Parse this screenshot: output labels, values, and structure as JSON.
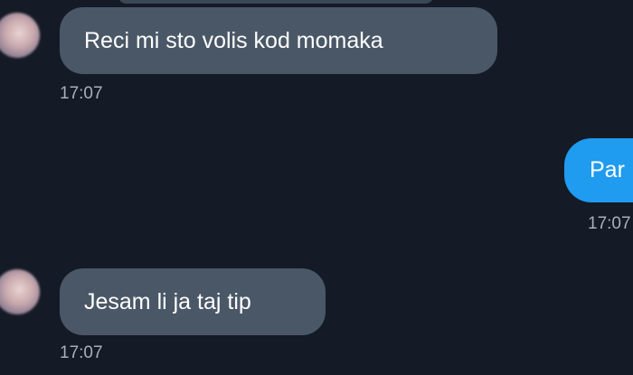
{
  "messages": [
    {
      "direction": "incoming",
      "text": "Reci mi sto volis kod momaka",
      "time": "17:07"
    },
    {
      "direction": "outgoing",
      "text": "Par",
      "time": "17:07"
    },
    {
      "direction": "incoming",
      "text": "Jesam li ja taj tip",
      "time": "17:07"
    }
  ],
  "colors": {
    "background": "#141a26",
    "incoming_bubble": "#4a5767",
    "outgoing_bubble": "#1f9bf0",
    "timestamp": "#a8b0ba"
  },
  "icons": {
    "avatar": "contact-avatar-icon"
  }
}
